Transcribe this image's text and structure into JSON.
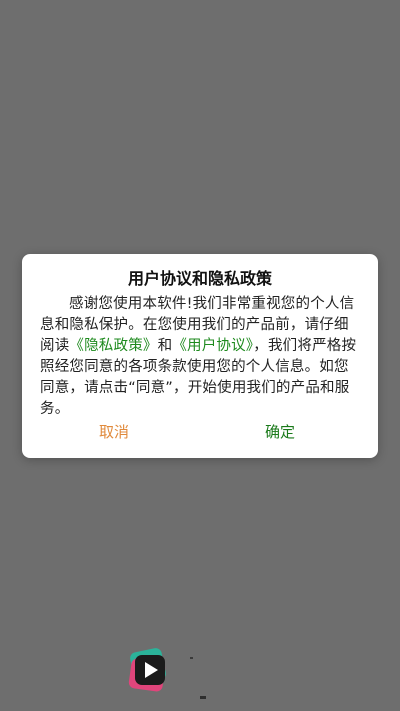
{
  "dialog": {
    "title": "用户协议和隐私政策",
    "body_part1": "感谢您使用本软件!我们非常重视您的个人信息和隐私保护。在您使用我们的产品前，请仔细阅读",
    "privacy_link": "《隐私政策》",
    "and_text": "和",
    "user_agreement_link": "《用户协议》",
    "body_part2": "，我们将严格按照经您同意的各项条款使用您的个人信息。如您同意，请点击“同意”，开始使用我们的产品和服务。",
    "cancel_label": "取消",
    "confirm_label": "确定"
  },
  "colors": {
    "overlay": "#6e6e6e",
    "link": "#1e8a1e",
    "cancel": "#e08a3c",
    "confirm": "#1a7a1a"
  },
  "icons": {
    "app_logo": "app-logo-icon"
  }
}
